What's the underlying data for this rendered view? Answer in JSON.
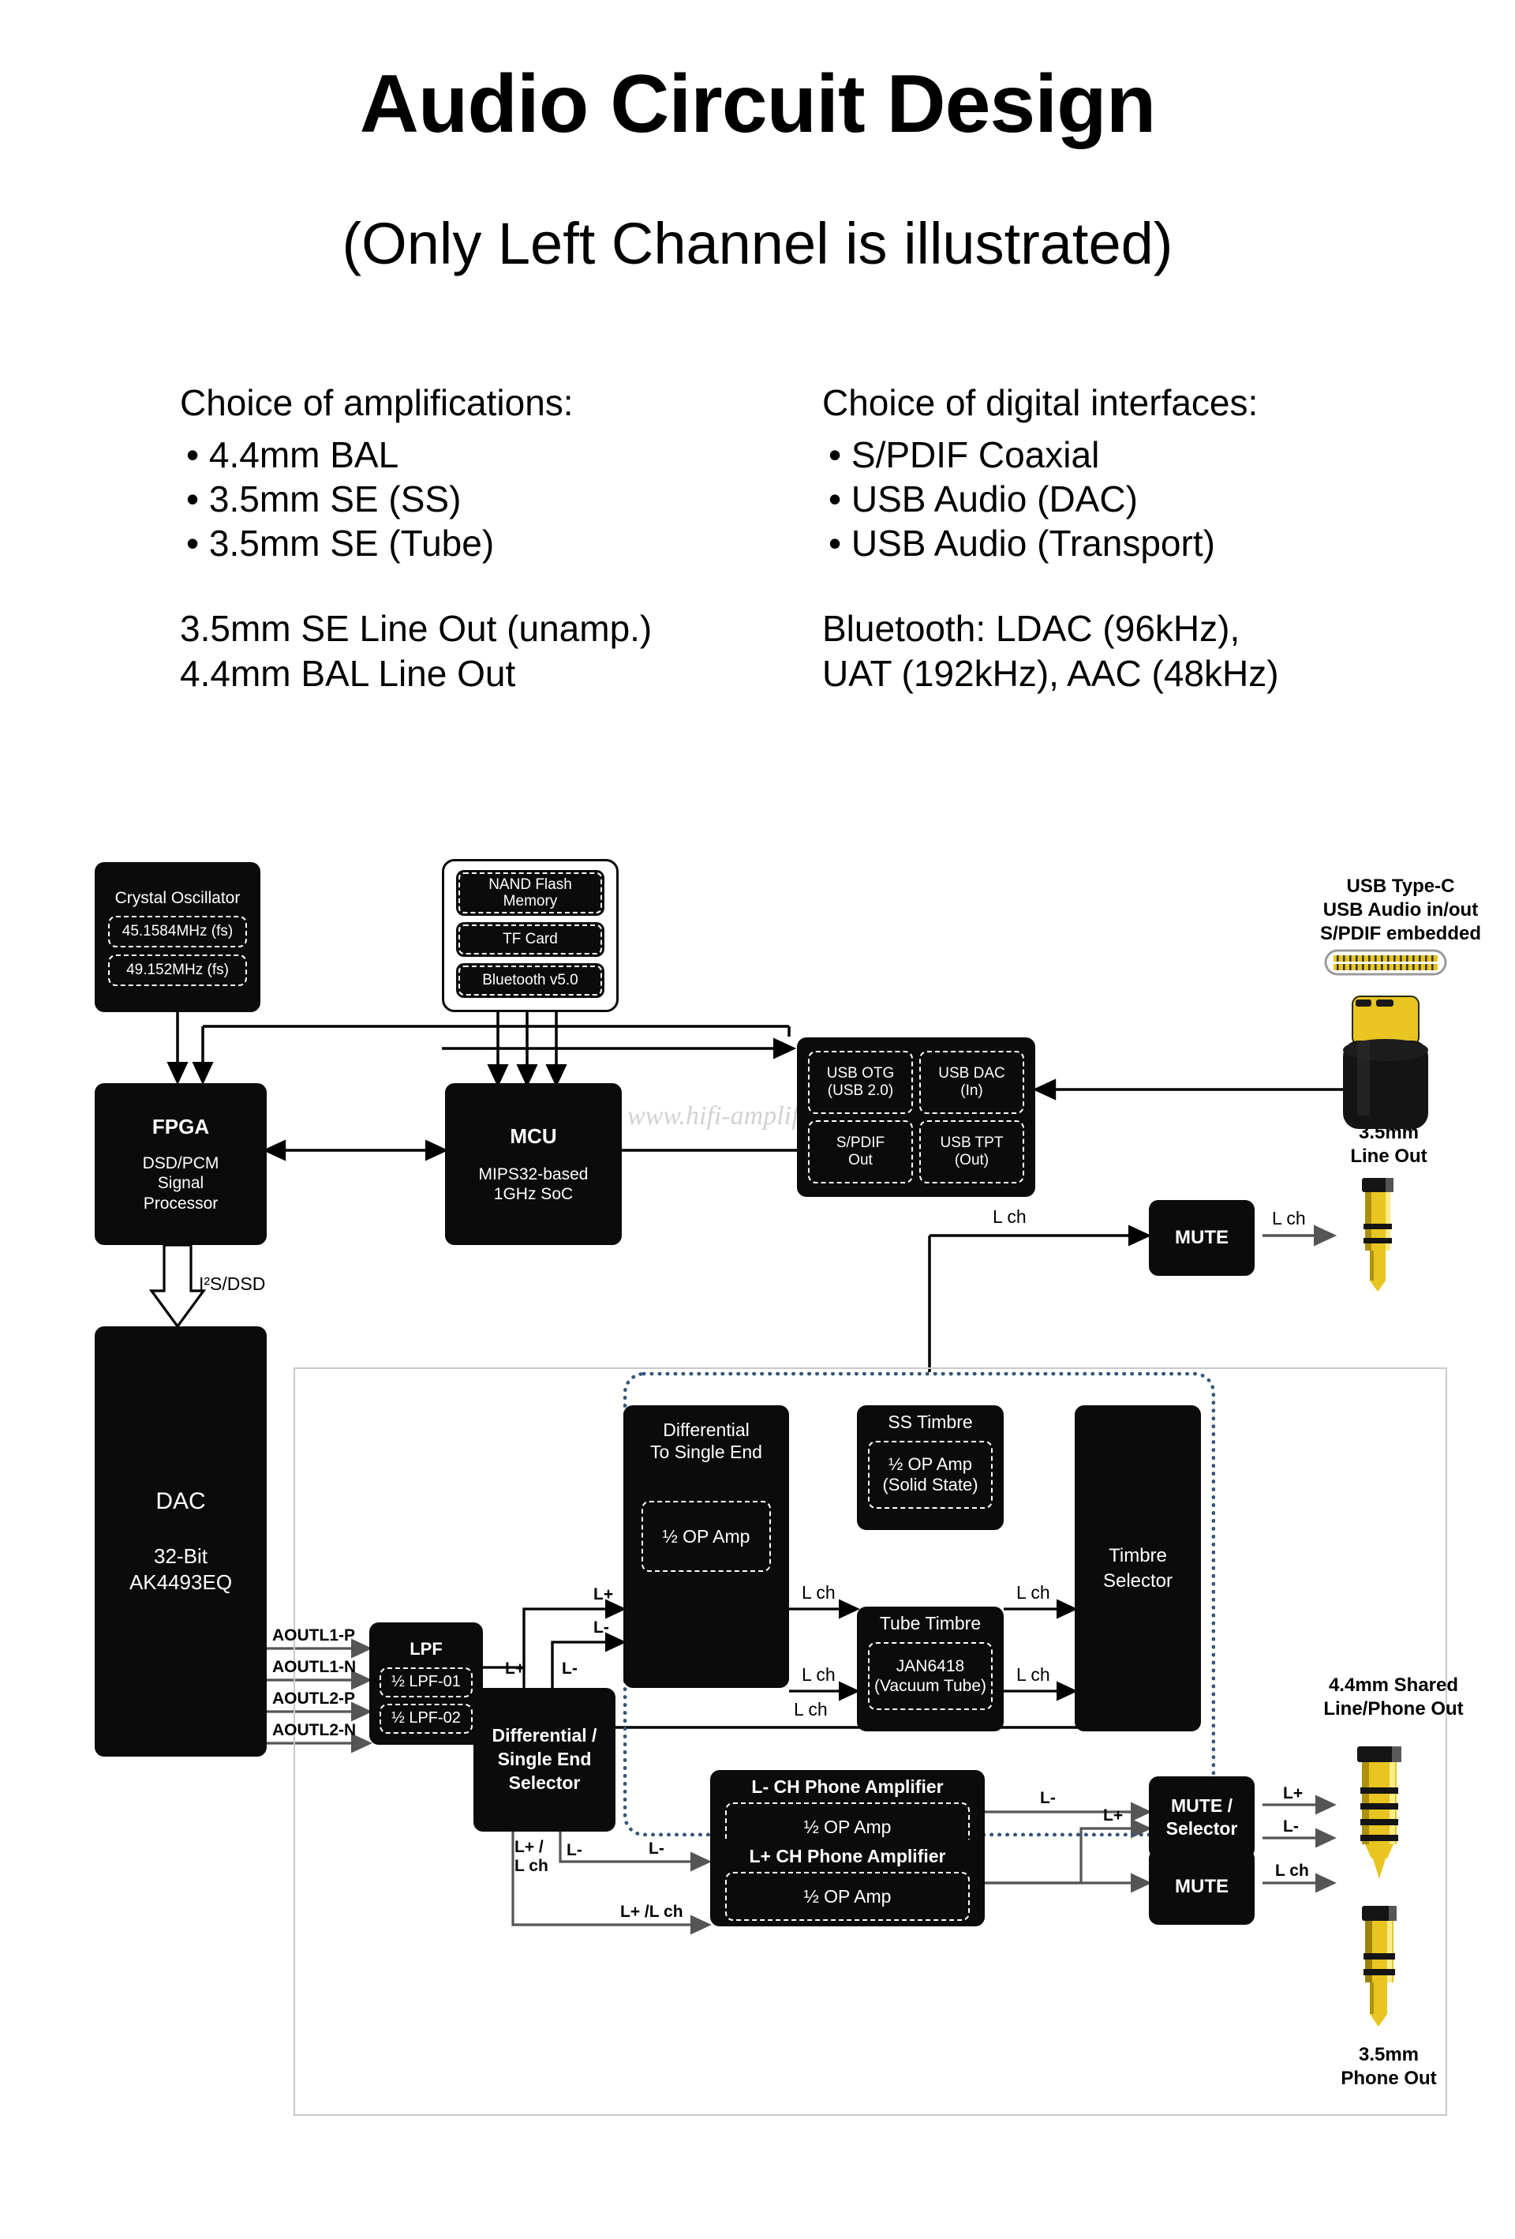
{
  "header": {
    "title": "Audio Circuit Design",
    "subtitle": "(Only Left Channel is illustrated)"
  },
  "amplifications": {
    "heading": "Choice of amplifications:",
    "items": [
      "• 4.4mm BAL",
      "• 3.5mm SE (SS)",
      "• 3.5mm SE (Tube)"
    ],
    "extra": [
      "3.5mm SE Line Out (unamp.)",
      "4.4mm BAL Line Out"
    ]
  },
  "digital_interfaces": {
    "heading": "Choice of digital interfaces:",
    "items": [
      "• S/PDIF Coaxial",
      "• USB Audio (DAC)",
      "• USB Audio (Transport)"
    ],
    "extra": [
      "Bluetooth: LDAC (96kHz),",
      "UAT (192kHz), AAC (48kHz)"
    ]
  },
  "watermark": "www.hifi-amplifiers.com",
  "blocks": {
    "crystal": {
      "title": "Crystal Oscillator",
      "osc1": "45.1584MHz (fs)",
      "osc2": "49.152MHz (fs)"
    },
    "storage": {
      "nand": "NAND Flash\nMemory",
      "tf": "TF Card",
      "bt": "Bluetooth v5.0"
    },
    "usbif": {
      "otg": "USB OTG\n(USB 2.0)",
      "dac_in": "USB DAC\n(In)",
      "spdif_out": "S/PDIF\nOut",
      "tpt_out": "USB TPT\n(Out)"
    },
    "fpga": {
      "title": "FPGA",
      "sub": "DSD/PCM\nSignal\nProcessor"
    },
    "mcu": {
      "title": "MCU",
      "sub": "MIPS32-based\n1GHz SoC"
    },
    "dac": {
      "title": "DAC",
      "sub": "32-Bit\nAK4493EQ"
    },
    "lpf": {
      "title": "LPF",
      "lpf01": "½ LPF-01",
      "lpf02": "½ LPF-02"
    },
    "diff2se": {
      "title": "Differential\nTo Single End",
      "opamp": "½ OP Amp"
    },
    "ss_timbre": {
      "title": "SS Timbre",
      "inner": "½ OP Amp\n(Solid State)"
    },
    "tube_timbre": {
      "title": "Tube Timbre",
      "inner": "JAN6418\n(Vacuum Tube)"
    },
    "timbre_selector": {
      "title": "Timbre\nSelector"
    },
    "diff_se_selector": {
      "title": "Differential /\nSingle End\nSelector"
    },
    "lminus_amp": {
      "title": "L- CH Phone Amplifier",
      "inner": "½ OP Amp"
    },
    "lplus_amp": {
      "title": "L+ CH Phone Amplifier",
      "inner": "½ OP Amp"
    },
    "mute_lineout": {
      "title": "MUTE"
    },
    "mute_selector": {
      "title": "MUTE /\nSelector"
    },
    "mute_phone": {
      "title": "MUTE"
    }
  },
  "captions": {
    "usb_typec": "USB Type-C\nUSB Audio in/out\nS/PDIF embedded",
    "line_out_35": "3.5mm\nLine Out",
    "shared_44": "4.4mm Shared\nLine/Phone Out",
    "phone_out_35": "3.5mm\nPhone Out"
  },
  "wire_labels": {
    "i2s": "I²S/DSD",
    "aoutl1p": "AOUTL1-P",
    "aoutl1n": "AOUTL1-N",
    "aoutl2p": "AOUTL2-P",
    "aoutl2n": "AOUTL2-N",
    "lplus_top": "L+",
    "lminus_top": "L-",
    "lplus_down": "L+",
    "lminus_down": "L-",
    "lch_ss_in": "L ch",
    "lch_ss_out": "L ch",
    "lch_tube_in": "L ch",
    "lch_tube_out": "L ch",
    "lch_feedback": "L ch",
    "lch_mute": "L ch",
    "lch_lineout": "L ch",
    "lplus_lch": "L+ /\nL ch",
    "lminus_sel": "L-",
    "lminus_amp_in": "L-",
    "lplus_amp_in": "L+ /L ch",
    "lminus_to_mutesel": "L-",
    "lplus_to_mutesel": "L+",
    "lplus_out": "L+",
    "lminus_out": "L-",
    "lch_phoneout": "L ch"
  },
  "colors": {
    "block_fill": "#0b0b0b",
    "timbre_zone": "#36557a",
    "jack_gold": "#e8c520",
    "frame": "#c9c9c9"
  }
}
